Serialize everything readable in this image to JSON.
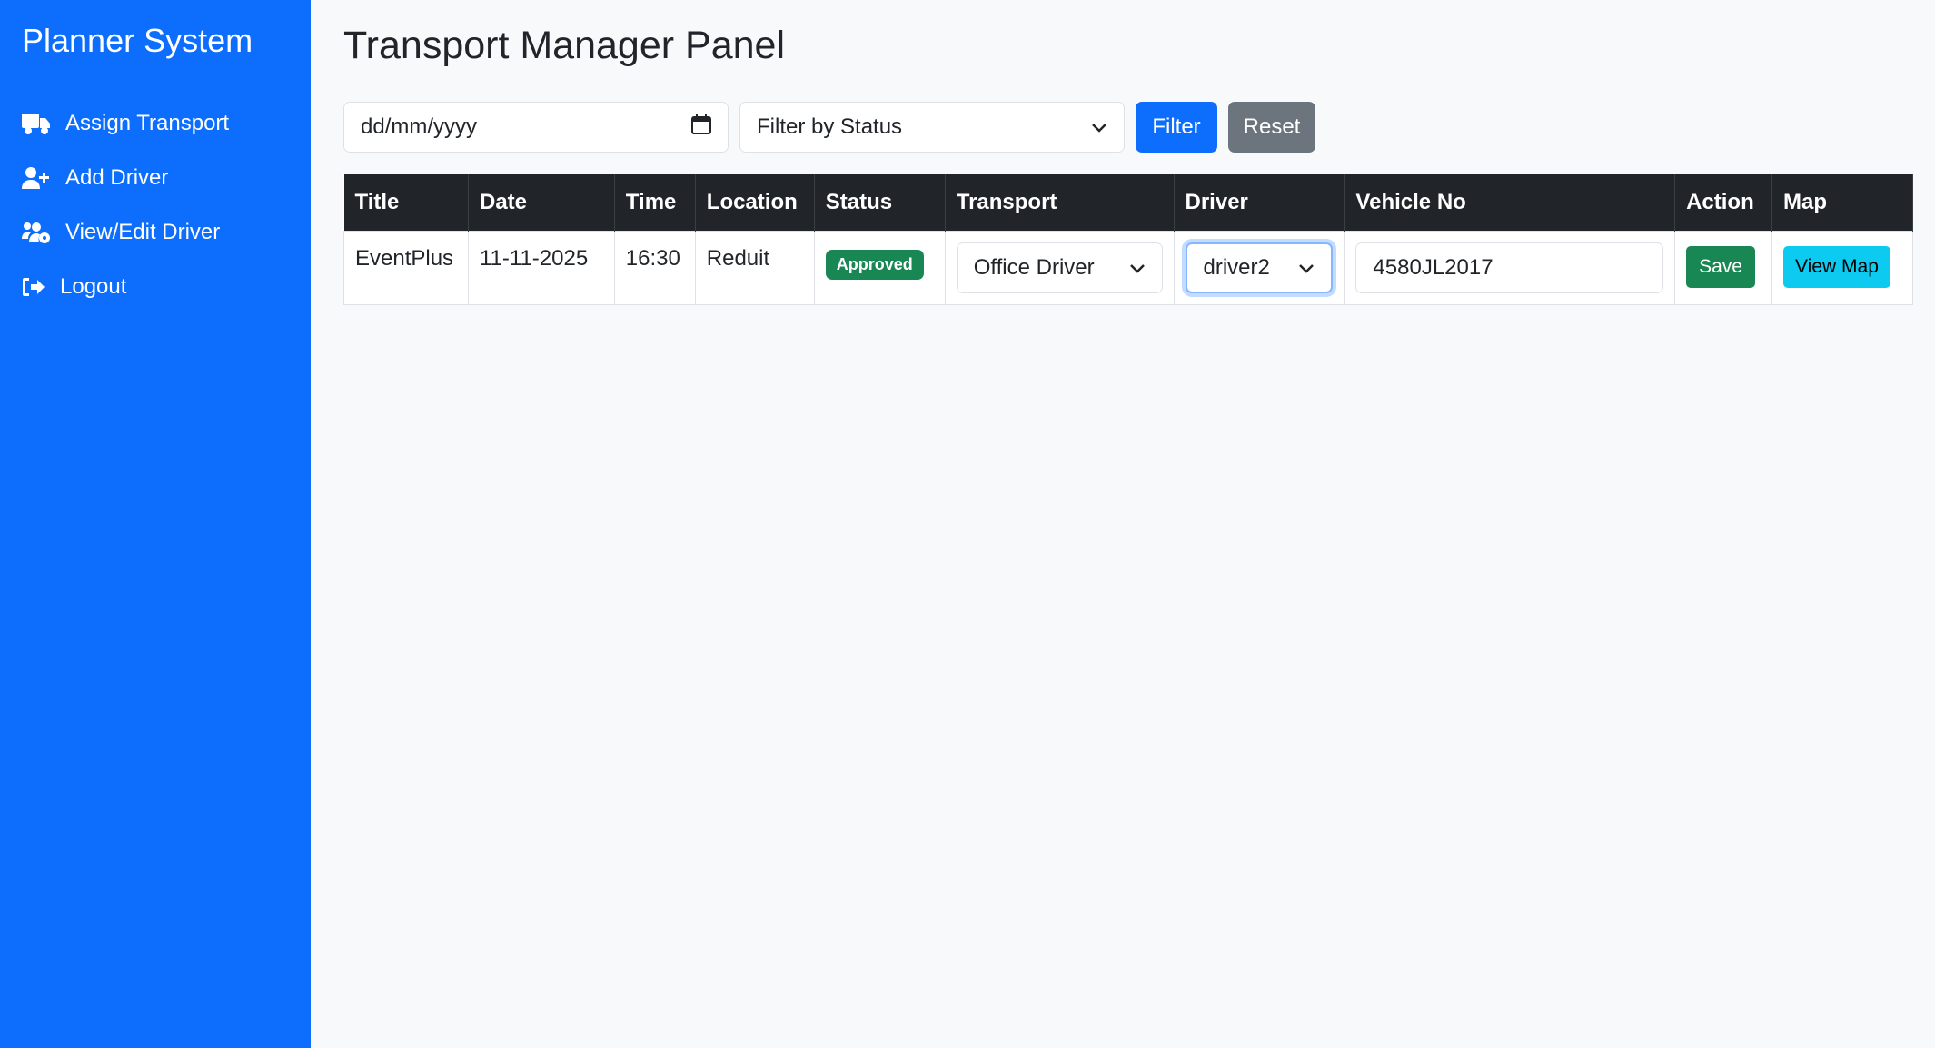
{
  "sidebar": {
    "brand": "Planner System",
    "items": [
      {
        "label": "Assign Transport",
        "icon": "truck-icon"
      },
      {
        "label": "Add Driver",
        "icon": "user-plus-icon"
      },
      {
        "label": "View/Edit Driver",
        "icon": "users-cog-icon"
      },
      {
        "label": "Logout",
        "icon": "sign-out-icon"
      }
    ]
  },
  "main": {
    "title": "Transport Manager Panel",
    "filters": {
      "date_placeholder": "dd/mm/yyyy",
      "status_label": "Filter by Status",
      "filter_button": "Filter",
      "reset_button": "Reset"
    },
    "table": {
      "headers": [
        "Title",
        "Date",
        "Time",
        "Location",
        "Status",
        "Transport",
        "Driver",
        "Vehicle No",
        "Action",
        "Map"
      ],
      "rows": [
        {
          "title": "EventPlus",
          "date": "11-11-2025",
          "time": "16:30",
          "location": "Reduit",
          "status": "Approved",
          "transport": "Office Driver",
          "driver": "driver2",
          "vehicle_no": "4580JL2017",
          "action": "Save",
          "map": "View Map"
        }
      ]
    }
  },
  "colors": {
    "sidebar": "#0d6efd",
    "primary": "#0d6efd",
    "secondary": "#6c757d",
    "success": "#198754",
    "info": "#0dcaf0",
    "header_dark": "#212529"
  }
}
